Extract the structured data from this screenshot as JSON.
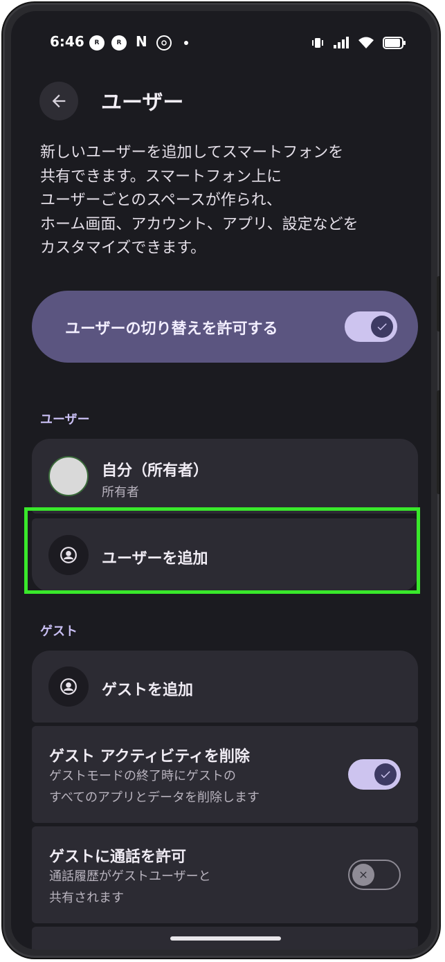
{
  "status_bar": {
    "time": "6:46",
    "notif_icons": [
      "R",
      "R"
    ],
    "n_label": "N"
  },
  "header": {
    "title": "ユーザー",
    "back_icon": "arrow-left-icon"
  },
  "description": "新しいユーザーを追加してスマートフォンを\n共有できます。スマートフォン上に\nユーザーごとのスペースが作られ、\nホーム画面、アカウント、アプリ、設定などを\nカスタマイズできます。",
  "allow_switch": {
    "label": "ユーザーの切り替えを許可する",
    "enabled": true
  },
  "users_section": {
    "label": "ユーザー",
    "owner": {
      "name": "自分（所有者）",
      "role": "所有者"
    },
    "add_user_label": "ユーザーを追加"
  },
  "guest_section": {
    "label": "ゲスト",
    "add_guest_label": "ゲストを追加",
    "delete_activity": {
      "title": "ゲスト アクティビティを削除",
      "subtitle": "ゲストモードの終了時にゲストの\nすべてのアプリとデータを削除します",
      "enabled": true
    },
    "allow_calls": {
      "title": "ゲストに通話を許可",
      "subtitle": "通話履歴がゲストユーザーと\n共有されます",
      "enabled": false
    }
  },
  "colors": {
    "background": "#1b1b20",
    "accent_card": "#5b5580",
    "toggle_on": "#cdc4ef",
    "section_label": "#c9bff3",
    "highlight": "#39e82b"
  }
}
